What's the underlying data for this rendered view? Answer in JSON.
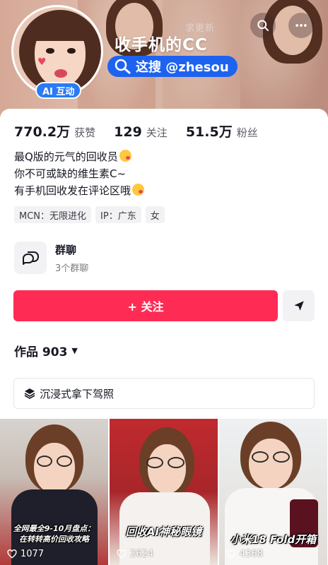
{
  "header": {
    "cover_overlay_text": "求更新",
    "nickname": "收手机的CC",
    "ai_badge": "AI 互动",
    "search_tag": "这搜 @zhesou"
  },
  "stats": [
    {
      "value": "770.2万",
      "label": "获赞"
    },
    {
      "value": "129",
      "label": "关注"
    },
    {
      "value": "51.5万",
      "label": "粉丝"
    }
  ],
  "bio": {
    "line1": "最Q版的元气的回收员",
    "line2": "你不可或缺的维生素C~",
    "line3": "有手机回收发在评论区哦"
  },
  "tags": [
    "MCN：无限进化",
    "IP：广东",
    "女"
  ],
  "group": {
    "title": "群聊",
    "subtitle": "3个群聊"
  },
  "actions": {
    "follow_label": "+ 关注"
  },
  "works": {
    "label": "作品 903"
  },
  "immersive": {
    "label": "沉浸式拿下驾照"
  },
  "videos": [
    {
      "caption_line1": "全网最全9-10月盘点：",
      "caption_line2": "在转转高价回收攻略",
      "likes": "1077"
    },
    {
      "caption_line1": "回收AI神秘眼镜",
      "likes": "2624"
    },
    {
      "caption_line1": "小米18 Fold开箱",
      "likes": "4368"
    }
  ],
  "colors": {
    "accent": "#fe2c55",
    "brand_blue": "#1d63f0"
  }
}
